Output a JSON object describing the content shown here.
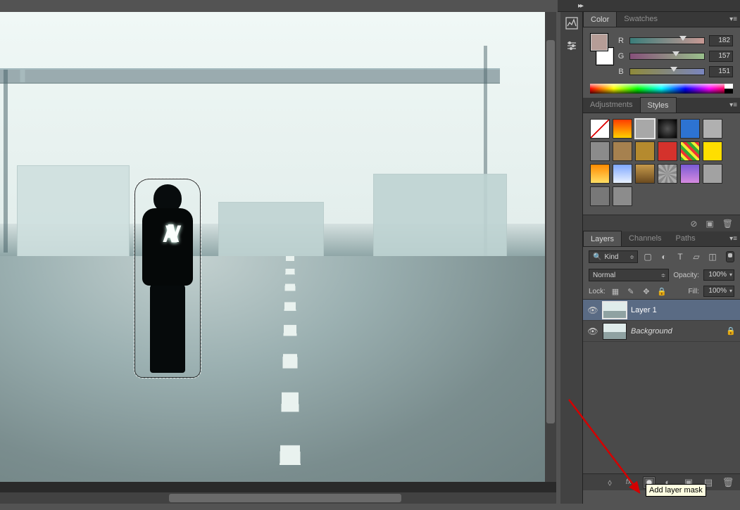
{
  "panels": {
    "color": {
      "tabs": [
        "Color",
        "Swatches"
      ],
      "active_tab": 0,
      "channels": [
        {
          "label": "R",
          "value": 182,
          "knob_pct": 71
        },
        {
          "label": "G",
          "value": 157,
          "knob_pct": 62
        },
        {
          "label": "B",
          "value": 151,
          "knob_pct": 59
        }
      ],
      "foreground": "#b69d97",
      "background": "#ffffff"
    },
    "styles": {
      "tabs": [
        "Adjustments",
        "Styles"
      ],
      "active_tab": 1,
      "selected_index": 2,
      "swatches": [
        "#ffffff:diag",
        "grad:#ff3c00,#ffd000",
        "#a8a8a8",
        "rad:#555,#000",
        "#2d73d2",
        "#b0b0b0",
        "#8b8b8b",
        "#a6814f",
        "#b58a2e",
        "#d4322c",
        "stripes",
        "#ffde00",
        "grad:#ff8a00,#ffde63",
        "grad:#7fa8ff,#e8f1ff",
        "grad:#c69a4b,#6b4a1f",
        "noise",
        "grad:#7a5bd6,#d68adf",
        "#a2a2a2",
        "#787878",
        "#8c8c8c"
      ]
    },
    "layers": {
      "tabs": [
        "Layers",
        "Channels",
        "Paths"
      ],
      "active_tab": 0,
      "filter_kind_label": "Kind",
      "filter_icons": [
        "image-icon",
        "adjustment-icon",
        "type-icon",
        "shape-icon",
        "smartobj-icon"
      ],
      "blend_mode": "Normal",
      "opacity_label": "Opacity:",
      "opacity_value": "100%",
      "lock_label": "Lock:",
      "lock_icons": [
        "transparent-lock",
        "brush-lock",
        "move-lock",
        "all-lock"
      ],
      "fill_label": "Fill:",
      "fill_value": "100%",
      "layers": [
        {
          "name": "Layer 1",
          "visible": true,
          "selected": true,
          "locked": false,
          "italic": false
        },
        {
          "name": "Background",
          "visible": true,
          "selected": false,
          "locked": true,
          "italic": true
        }
      ],
      "footer_icons": [
        "link-icon",
        "fx-icon",
        "mask-icon",
        "adjustment-layer-icon",
        "group-icon",
        "new-layer-icon",
        "trash-icon"
      ]
    }
  },
  "tooltip": {
    "text": "Add layer mask"
  },
  "filter_kind_placeholder": "Kind",
  "search_sym": "◎"
}
